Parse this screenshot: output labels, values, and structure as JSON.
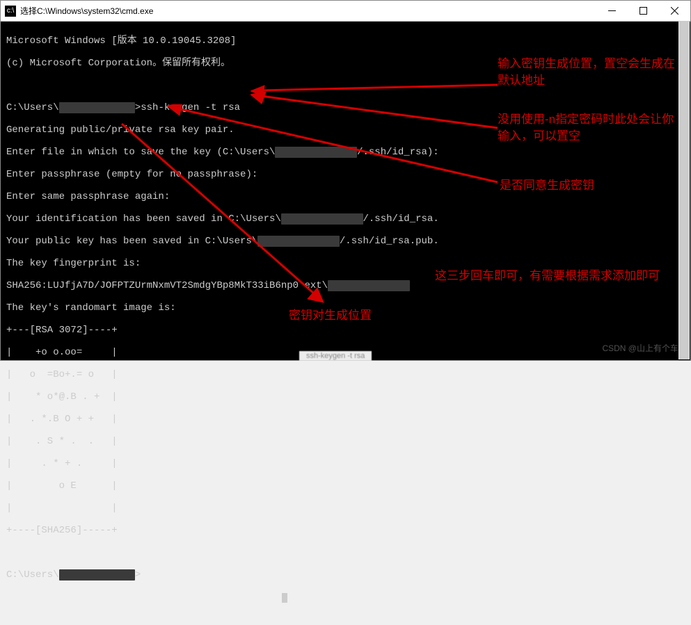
{
  "title": "选择C:\\Windows\\system32\\cmd.exe",
  "terminal": {
    "l1": "Microsoft Windows [版本 10.0.19045.3208]",
    "l2": "(c) Microsoft Corporation。保留所有权利。",
    "l3a": "C:\\Users\\",
    "l3b": ">ssh-keygen -t rsa",
    "l4": "Generating public/private rsa key pair.",
    "l5a": "Enter file in which to save the key (C:\\Users\\",
    "l5b": "/.ssh/id_rsa):",
    "l6": "Enter passphrase (empty for no passphrase):",
    "l7": "Enter same passphrase again:",
    "l8a": "Your identification has been saved in C:\\Users\\",
    "l8b": "/.ssh/id_rsa.",
    "l9a": "Your public key has been saved in C:\\Users\\",
    "l9b": "/.ssh/id_rsa.pub.",
    "l10": "The key fingerprint is:",
    "l11a": "SHA256:LUJfjA7D/JOFPTZUrmNxmVT2SmdgYBp8MkT33iB6np0 ext\\",
    "l12": "The key's randomart image is:",
    "art1": "+---[RSA 3072]----+",
    "art2": "|    +o o.oo=     |",
    "art3": "|   o  =Bo+.= o   |",
    "art4": "|    * o*@.B . +  |",
    "art5": "|   . *.B O + +   |",
    "art6": "|    . S * .  .   |",
    "art7": "|     . * + .     |",
    "art8": "|        o E      |",
    "art9": "|                 |",
    "art10": "+----[SHA256]-----+",
    "l13a": "C:\\Users\\",
    "l13b": ">"
  },
  "annotations": {
    "a1": "输入密钥生成位置，置空会生成在默认地址",
    "a2": "没用使用-n指定密码时此处会让你输入，可以置空",
    "a3": "是否同意生成密钥",
    "a4": "这三步回车即可，有需要根据需求添加即可",
    "a5": "密钥对生成位置"
  },
  "watermark": "CSDN @山上有个车",
  "bottom_tab": "ssh-keygen -t rsa"
}
